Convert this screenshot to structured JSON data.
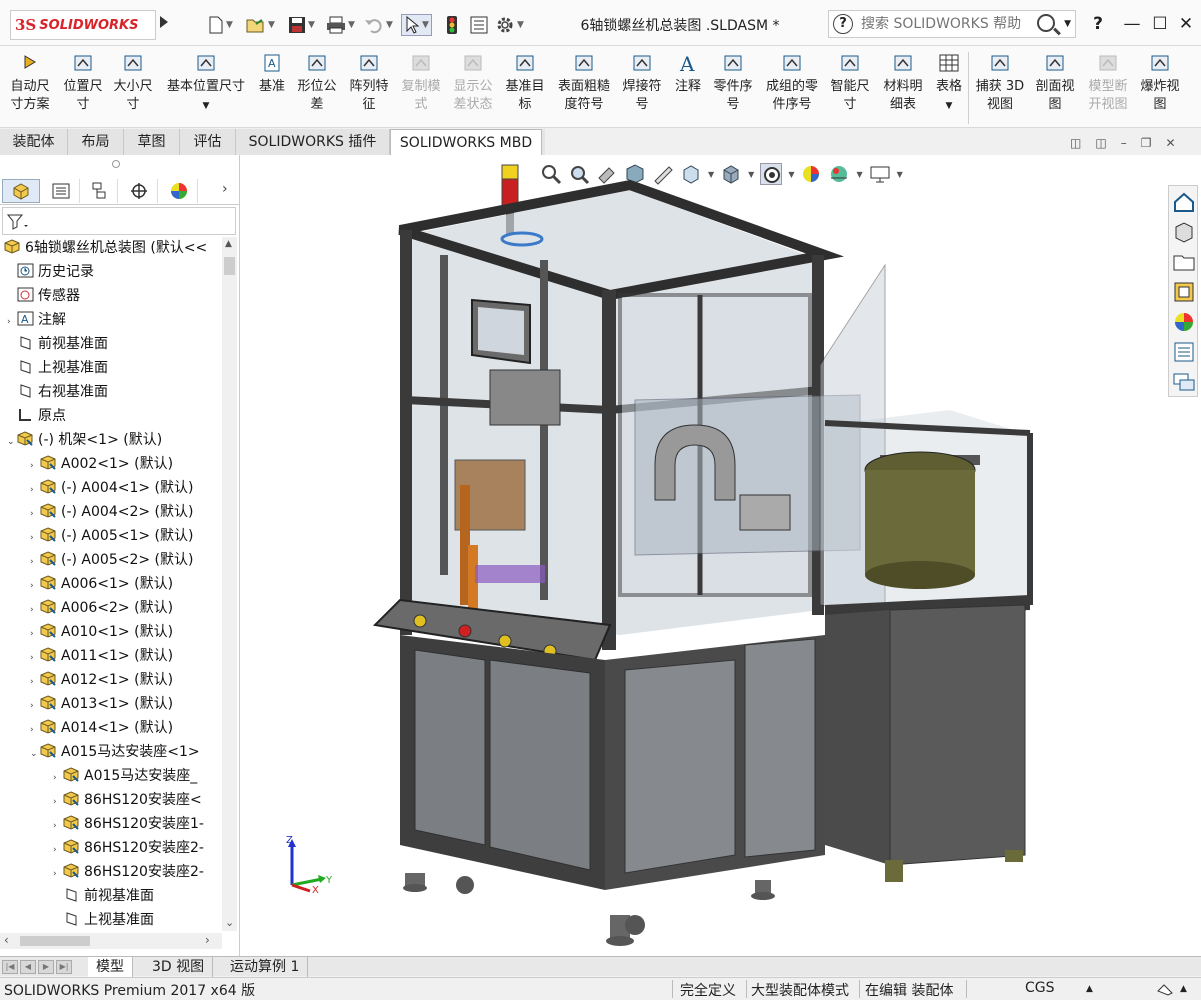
{
  "app": {
    "logo_prefix": "3S",
    "logo_text": "SOLIDWORKS",
    "doc_title": "6轴锁螺丝机总装图 .SLDASM *"
  },
  "search": {
    "placeholder": "搜索 SOLIDWORKS 帮助"
  },
  "window": {
    "help": "?",
    "minimize": "—",
    "maximize": "☐",
    "close": "✕"
  },
  "ribbon": {
    "items": [
      {
        "label1": "自动尺",
        "label2": "寸方案",
        "icon": "auto-dimension-icon"
      },
      {
        "label1": "位置尺",
        "label2": "寸",
        "icon": "location-dimension-icon"
      },
      {
        "label1": "大小尺",
        "label2": "寸",
        "icon": "size-dimension-icon"
      },
      {
        "label1": "基本位置尺寸",
        "label2": "",
        "icon": "basic-location-dimension-icon"
      },
      {
        "label1": "基准",
        "label2": "",
        "icon": "datum-icon"
      },
      {
        "label1": "形位公",
        "label2": "差",
        "icon": "geometric-tolerance-icon"
      },
      {
        "label1": "阵列特",
        "label2": "征",
        "icon": "pattern-feature-icon"
      },
      {
        "label1": "复制模",
        "label2": "式",
        "icon": "copy-scheme-icon"
      },
      {
        "label1": "显示公",
        "label2": "差状态",
        "icon": "show-tolerance-status-icon"
      },
      {
        "label1": "基准目",
        "label2": "标",
        "icon": "datum-target-icon"
      },
      {
        "label1": "表面粗糙",
        "label2": "度符号",
        "icon": "surface-finish-icon"
      },
      {
        "label1": "焊接符",
        "label2": "号",
        "icon": "weld-symbol-icon"
      },
      {
        "label1": "注释",
        "label2": "",
        "icon": "note-icon"
      },
      {
        "label1": "零件序",
        "label2": "号",
        "icon": "balloon-icon"
      },
      {
        "label1": "成组的零",
        "label2": "件序号",
        "icon": "stacked-balloon-icon"
      },
      {
        "label1": "智能尺",
        "label2": "寸",
        "icon": "smart-dimension-icon"
      },
      {
        "label1": "材料明",
        "label2": "细表",
        "icon": "bom-icon"
      },
      {
        "label1": "表格",
        "label2": "",
        "icon": "table-icon"
      },
      {
        "label1": "捕获 3D",
        "label2": "视图",
        "icon": "capture-3d-view-icon"
      },
      {
        "label1": "剖面视",
        "label2": "图",
        "icon": "section-view-icon"
      },
      {
        "label1": "模型断",
        "label2": "开视图",
        "icon": "model-break-view-icon"
      },
      {
        "label1": "爆炸视",
        "label2": "图",
        "icon": "exploded-view-icon"
      }
    ]
  },
  "tabs": [
    "装配体",
    "布局",
    "草图",
    "评估",
    "SOLIDWORKS 插件",
    "SOLIDWORKS MBD"
  ],
  "tree": {
    "root": "6轴锁螺丝机总装图 (默认<<",
    "items": [
      {
        "label": "历史记录",
        "indent": 1,
        "exp": "",
        "icon": "history"
      },
      {
        "label": "传感器",
        "indent": 1,
        "exp": "",
        "icon": "sensor"
      },
      {
        "label": "注解",
        "indent": 1,
        "exp": "›",
        "icon": "annotation"
      },
      {
        "label": "前视基准面",
        "indent": 1,
        "exp": "",
        "icon": "plane"
      },
      {
        "label": "上视基准面",
        "indent": 1,
        "exp": "",
        "icon": "plane"
      },
      {
        "label": "右视基准面",
        "indent": 1,
        "exp": "",
        "icon": "plane"
      },
      {
        "label": "原点",
        "indent": 1,
        "exp": "",
        "icon": "origin"
      },
      {
        "label": "(-) 机架<1> (默认)",
        "indent": 1,
        "exp": "⌄",
        "icon": "assembly"
      },
      {
        "label": "A002<1> (默认)",
        "indent": 2,
        "exp": "›",
        "icon": "assembly"
      },
      {
        "label": "(-) A004<1> (默认)",
        "indent": 2,
        "exp": "›",
        "icon": "assembly"
      },
      {
        "label": "(-) A004<2> (默认)",
        "indent": 2,
        "exp": "›",
        "icon": "assembly"
      },
      {
        "label": "(-) A005<1> (默认)",
        "indent": 2,
        "exp": "›",
        "icon": "assembly"
      },
      {
        "label": "(-) A005<2> (默认)",
        "indent": 2,
        "exp": "›",
        "icon": "assembly"
      },
      {
        "label": "A006<1> (默认)",
        "indent": 2,
        "exp": "›",
        "icon": "assembly"
      },
      {
        "label": "A006<2> (默认)",
        "indent": 2,
        "exp": "›",
        "icon": "assembly"
      },
      {
        "label": "A010<1> (默认)",
        "indent": 2,
        "exp": "›",
        "icon": "assembly"
      },
      {
        "label": "A011<1> (默认)",
        "indent": 2,
        "exp": "›",
        "icon": "assembly"
      },
      {
        "label": "A012<1> (默认)",
        "indent": 2,
        "exp": "›",
        "icon": "assembly"
      },
      {
        "label": "A013<1> (默认)",
        "indent": 2,
        "exp": "›",
        "icon": "assembly"
      },
      {
        "label": "A014<1> (默认)",
        "indent": 2,
        "exp": "›",
        "icon": "assembly"
      },
      {
        "label": "A015马达安装座<1>",
        "indent": 2,
        "exp": "⌄",
        "icon": "assembly"
      },
      {
        "label": "A015马达安装座_",
        "indent": 3,
        "exp": "›",
        "icon": "assembly"
      },
      {
        "label": "86HS120安装座<",
        "indent": 3,
        "exp": "›",
        "icon": "assembly"
      },
      {
        "label": "86HS120安装座1-",
        "indent": 3,
        "exp": "›",
        "icon": "assembly"
      },
      {
        "label": "86HS120安装座2-",
        "indent": 3,
        "exp": "›",
        "icon": "assembly"
      },
      {
        "label": "86HS120安装座2-",
        "indent": 3,
        "exp": "›",
        "icon": "assembly"
      },
      {
        "label": "前视基准面",
        "indent": 3,
        "exp": "",
        "icon": "plane"
      },
      {
        "label": "上视基准面",
        "indent": 3,
        "exp": "",
        "icon": "plane"
      }
    ]
  },
  "bottom_tabs": [
    "模型",
    "3D 视图",
    "运动算例 1"
  ],
  "status": {
    "product": "SOLIDWORKS Premium 2017 x64 版",
    "defined": "完全定义",
    "mode": "大型装配体模式",
    "editing": "在编辑 装配体",
    "units": "CGS"
  },
  "triad": {
    "x": "X",
    "y": "Y",
    "z": "Z"
  },
  "colors": {
    "accent": "#d8232a",
    "frame_dark": "#3a3a3a",
    "glass": "#9fb3c8",
    "bowl": "#6b6a3a"
  }
}
